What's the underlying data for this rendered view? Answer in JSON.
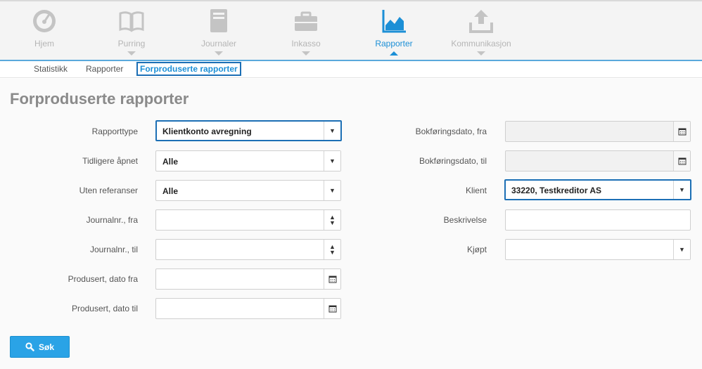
{
  "nav": {
    "items": [
      {
        "label": "Hjem",
        "icon": "gauge-icon"
      },
      {
        "label": "Purring",
        "icon": "book-icon"
      },
      {
        "label": "Journaler",
        "icon": "journal-icon"
      },
      {
        "label": "Inkasso",
        "icon": "briefcase-icon"
      },
      {
        "label": "Rapporter",
        "icon": "area-chart-icon",
        "active": true
      },
      {
        "label": "Kommunikasjon",
        "icon": "upload-icon"
      }
    ]
  },
  "subnav": {
    "tabs": [
      {
        "label": "Statistikk"
      },
      {
        "label": "Rapporter"
      },
      {
        "label": "Forproduserte rapporter",
        "active": true
      }
    ]
  },
  "page": {
    "title": "Forproduserte rapporter"
  },
  "form": {
    "rapporttype": {
      "label": "Rapporttype",
      "value": "Klientkonto avregning"
    },
    "tidligere_apnet": {
      "label": "Tidligere åpnet",
      "value": "Alle"
    },
    "uten_referanser": {
      "label": "Uten referanser",
      "value": "Alle"
    },
    "journalnr_fra": {
      "label": "Journalnr., fra",
      "value": ""
    },
    "journalnr_til": {
      "label": "Journalnr., til",
      "value": ""
    },
    "produsert_fra": {
      "label": "Produsert, dato fra",
      "value": ""
    },
    "produsert_til": {
      "label": "Produsert, dato til",
      "value": ""
    },
    "bokforingsdato_fra": {
      "label": "Bokføringsdato, fra",
      "value": ""
    },
    "bokforingsdato_til": {
      "label": "Bokføringsdato, til",
      "value": ""
    },
    "klient": {
      "label": "Klient",
      "value": "33220, Testkreditor AS"
    },
    "beskrivelse": {
      "label": "Beskrivelse",
      "value": ""
    },
    "kjopt": {
      "label": "Kjøpt",
      "value": ""
    }
  },
  "actions": {
    "search_label": "Søk"
  },
  "colors": {
    "accent": "#1c8fd6",
    "button": "#2aa3e6",
    "focus_border": "#1c6fb5"
  }
}
